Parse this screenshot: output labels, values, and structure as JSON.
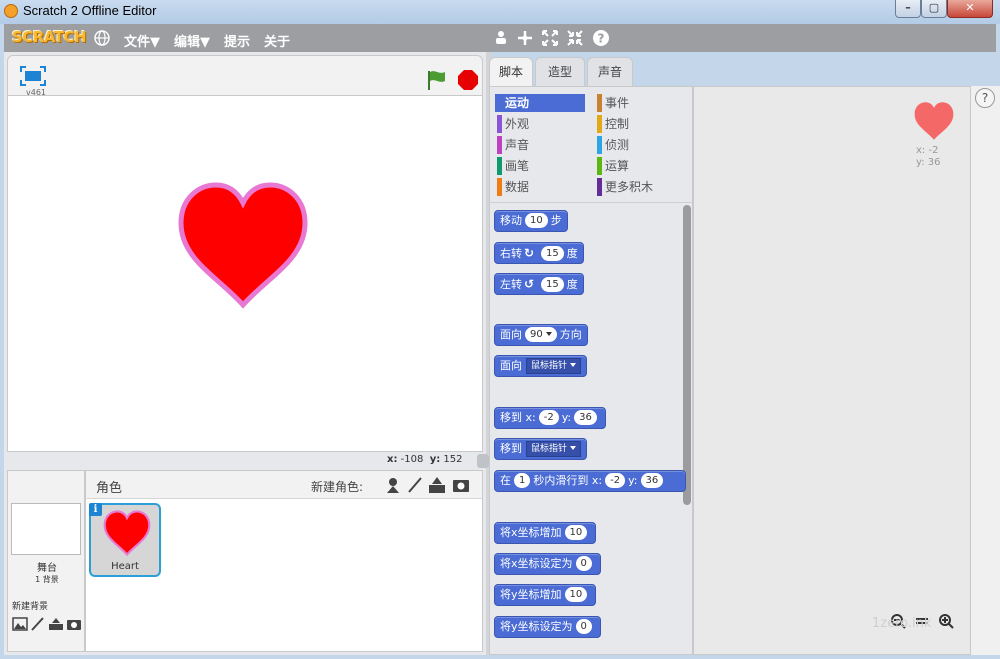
{
  "window": {
    "title": "Scratch 2 Offline Editor"
  },
  "menubar": {
    "logo": "SCRATCH",
    "items": [
      "文件▼",
      "编辑▼",
      "提示",
      "关于"
    ],
    "tools": [
      "duplicate-icon",
      "cut-icon",
      "grow-icon",
      "shrink-icon",
      "help-icon"
    ]
  },
  "stage": {
    "version": "v461",
    "coords": {
      "x_label": "x:",
      "x": "-108",
      "y_label": "y:",
      "y": "152"
    }
  },
  "sprites": {
    "header": "角色",
    "new_sprite_label": "新建角色:",
    "stage_label": "舞台",
    "backdrop_count": "1 背景",
    "new_backdrop_label": "新建背景",
    "items": [
      {
        "name": "Heart",
        "selected": true
      }
    ]
  },
  "tabs": [
    {
      "label": "脚本",
      "active": true
    },
    {
      "label": "造型",
      "active": false
    },
    {
      "label": "声音",
      "active": false
    }
  ],
  "categories": [
    {
      "label": "运动",
      "color": "#4a6cd4",
      "active": true
    },
    {
      "label": "事件",
      "color": "#c88330",
      "active": false
    },
    {
      "label": "外观",
      "color": "#8a55d7",
      "active": false
    },
    {
      "label": "控制",
      "color": "#e1a91a",
      "active": false
    },
    {
      "label": "声音",
      "color": "#bb42c3",
      "active": false
    },
    {
      "label": "侦测",
      "color": "#2ca5e2",
      "active": false
    },
    {
      "label": "画笔",
      "color": "#0e9a6c",
      "active": false
    },
    {
      "label": "运算",
      "color": "#5cb712",
      "active": false
    },
    {
      "label": "数据",
      "color": "#ee7d16",
      "active": false
    },
    {
      "label": "更多积木",
      "color": "#632d99",
      "active": false
    }
  ],
  "blocks": {
    "move": {
      "a": "移动",
      "n": "10",
      "b": "步"
    },
    "turn_right": {
      "a": "右转",
      "n": "15",
      "b": "度"
    },
    "turn_left": {
      "a": "左转",
      "n": "15",
      "b": "度"
    },
    "point_dir": {
      "a": "面向",
      "n": "90",
      "b": "方向"
    },
    "point_towards": {
      "a": "面向",
      "d": "鼠标指针"
    },
    "goto_xy": {
      "a": "移到 x:",
      "x": "-2",
      "y_label": "y:",
      "y": "36"
    },
    "goto": {
      "a": "移到",
      "d": "鼠标指针"
    },
    "glide": {
      "a": "在",
      "n": "1",
      "b": "秒内滑行到 x:",
      "x": "-2",
      "y_label": "y:",
      "y": "36"
    },
    "change_x": {
      "a": "将x坐标增加",
      "n": "10"
    },
    "set_x": {
      "a": "将x坐标设定为",
      "n": "0"
    },
    "change_y": {
      "a": "将y坐标增加",
      "n": "10"
    },
    "set_y": {
      "a": "将y坐标设定为",
      "n": "0"
    }
  },
  "scripts": {
    "sprite_info": {
      "x_label": "x:",
      "x": "-2",
      "y_label": "y:",
      "y": "36"
    }
  },
  "watermark": "1zero.ink",
  "colors": {
    "motion": "#4a6cd4",
    "heart": "#ff0000",
    "selected_border": "#2b9fd8"
  }
}
